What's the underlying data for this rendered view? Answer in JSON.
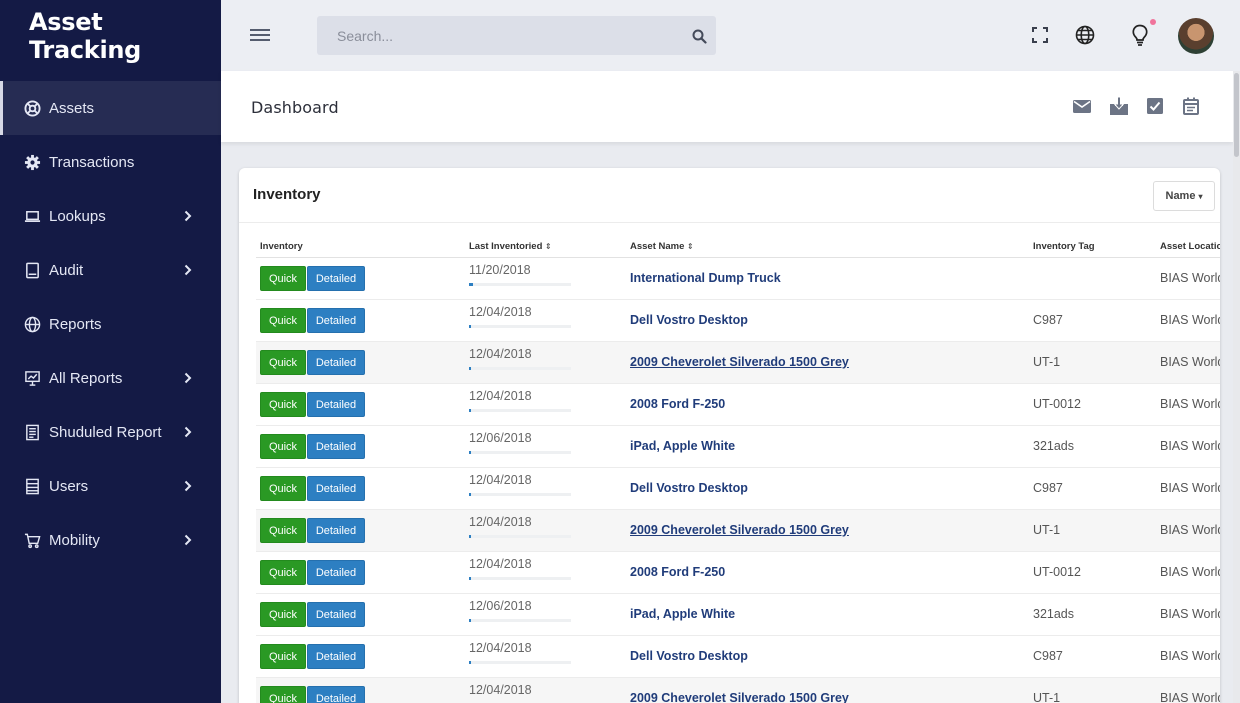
{
  "app": {
    "title": "Asset Tracking"
  },
  "sidebar": {
    "items": [
      {
        "label": "Assets",
        "icon": "life-ring-icon",
        "active": true,
        "has_submenu": false
      },
      {
        "label": "Transactions",
        "icon": "gear-icon",
        "active": false,
        "has_submenu": false
      },
      {
        "label": "Lookups",
        "icon": "laptop-icon",
        "active": false,
        "has_submenu": true
      },
      {
        "label": "Audit",
        "icon": "tablet-icon",
        "active": false,
        "has_submenu": true
      },
      {
        "label": "Reports",
        "icon": "globe-icon",
        "active": false,
        "has_submenu": false
      },
      {
        "label": "All Reports",
        "icon": "presentation-chart-icon",
        "active": false,
        "has_submenu": true
      },
      {
        "label": "Shuduled Report",
        "icon": "document-list-icon",
        "active": false,
        "has_submenu": true
      },
      {
        "label": "Users",
        "icon": "server-list-icon",
        "active": false,
        "has_submenu": true
      },
      {
        "label": "Mobility",
        "icon": "cart-icon",
        "active": false,
        "has_submenu": true
      }
    ]
  },
  "topbar": {
    "search_placeholder": "Search...",
    "icons": [
      "fullscreen-icon",
      "globe-icon",
      "lightbulb-icon",
      "avatar"
    ]
  },
  "page": {
    "title": "Dashboard",
    "header_icons": [
      "mail-icon",
      "download-icon",
      "checkbox-icon",
      "calendar-icon"
    ]
  },
  "inventory": {
    "title": "Inventory",
    "sort_label": "Name",
    "columns": [
      "Inventory",
      "Last Inventoried",
      "Asset Name",
      "Inventory Tag",
      "Asset Location"
    ],
    "quick_label": "Quick",
    "detailed_label": "Detailed",
    "rows": [
      {
        "date": "11/20/2018",
        "progress": 0.04,
        "asset": "International Dump Truck",
        "tag": "",
        "location": "BIAS Worldwide",
        "underline": false
      },
      {
        "date": "12/04/2018",
        "progress": 0.01,
        "asset": "Dell Vostro Desktop",
        "tag": "C987",
        "location": "BIAS Worldwide",
        "underline": false
      },
      {
        "date": "12/04/2018",
        "progress": 0.01,
        "asset": "2009 Cheverolet Silverado 1500 Grey",
        "tag": "UT-1",
        "location": "BIAS Worldwide",
        "underline": true
      },
      {
        "date": "12/04/2018",
        "progress": 0.01,
        "asset": "2008 Ford F-250",
        "tag": "UT-0012",
        "location": "BIAS Worldwide",
        "underline": false
      },
      {
        "date": "12/06/2018",
        "progress": 0.01,
        "asset": "iPad, Apple White",
        "tag": "321ads",
        "location": "BIAS Worldwide",
        "underline": false
      },
      {
        "date": "12/04/2018",
        "progress": 0.01,
        "asset": "Dell Vostro Desktop",
        "tag": "C987",
        "location": "BIAS Worldwide",
        "underline": false
      },
      {
        "date": "12/04/2018",
        "progress": 0.01,
        "asset": "2009 Cheverolet Silverado 1500 Grey",
        "tag": "UT-1",
        "location": "BIAS Worldwide",
        "underline": true
      },
      {
        "date": "12/04/2018",
        "progress": 0.01,
        "asset": "2008 Ford F-250",
        "tag": "UT-0012",
        "location": "BIAS Worldwide",
        "underline": false
      },
      {
        "date": "12/06/2018",
        "progress": 0.01,
        "asset": "iPad, Apple White",
        "tag": "321ads",
        "location": "BIAS Worldwide",
        "underline": false
      },
      {
        "date": "12/04/2018",
        "progress": 0.01,
        "asset": "Dell Vostro Desktop",
        "tag": "C987",
        "location": "BIAS Worldwide",
        "underline": false
      },
      {
        "date": "12/04/2018",
        "progress": 0.01,
        "asset": "2009 Cheverolet Silverado 1500 Grey",
        "tag": "UT-1",
        "location": "BIAS Worldwide",
        "underline": false
      }
    ]
  }
}
